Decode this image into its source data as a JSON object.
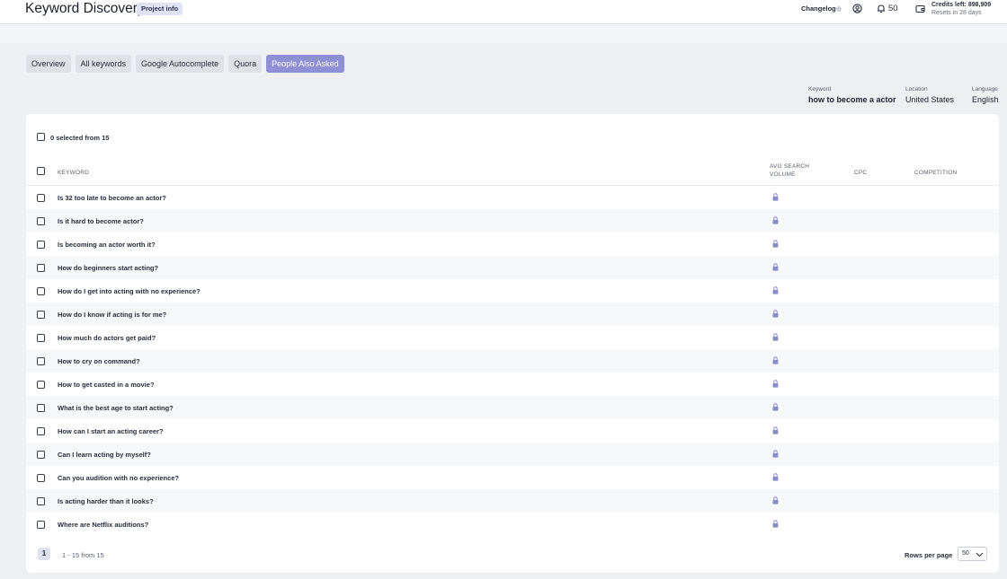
{
  "header": {
    "title": "Keyword Discovery",
    "project_badge": "Project info",
    "changelog": "Changelog",
    "notifications_count": "50",
    "credits_line1": "Credits left: 898,909",
    "credits_line2": "Resets in 28 days"
  },
  "tabs": [
    {
      "label": "Overview",
      "active": false
    },
    {
      "label": "All keywords",
      "active": false
    },
    {
      "label": "Google Autocomplete",
      "active": false
    },
    {
      "label": "Quora",
      "active": false
    },
    {
      "label": "People Also Asked",
      "active": true
    }
  ],
  "filters": {
    "keyword_label": "Keyword",
    "keyword_value": "how to become a actor",
    "location_label": "Location",
    "location_value": "United States",
    "language_label": "Language",
    "language_value": "English"
  },
  "table": {
    "selected_text": "0 selected from 15",
    "columns": {
      "keyword": "KEYWORD",
      "volume_line1": "AVG SEARCH",
      "volume_line2": "VOLUME",
      "cpc": "CPC",
      "competition": "COMPETITION"
    },
    "rows": [
      "Is 32 too late to become an actor?",
      "Is it hard to become actor?",
      "Is becoming an actor worth it?",
      "How do beginners start acting?",
      "How do I get into acting with no experience?",
      "How do I know if acting is for me?",
      "How much do actors get paid?",
      "How to cry on command?",
      "How to get casted in a movie?",
      "What is the best age to start acting?",
      "How can I start an acting career?",
      "Can I learn acting by myself?",
      "Can you audition with no experience?",
      "Is acting harder than it looks?",
      "Where are Netflix auditions?"
    ]
  },
  "pagination": {
    "current_page": "1",
    "range_text": "1 - 15 from 15",
    "rows_per_page_label": "Rows per page",
    "rows_per_page_value": "50"
  },
  "icons": {
    "user": "user-circle-icon",
    "bell": "bell-icon",
    "credits": "wallet-icon",
    "lock": "lock-icon",
    "select_arrow": "chevron-down-icon"
  },
  "colors": {
    "accent": "#8f8fd6",
    "lock": "#8a8cc7",
    "background": "#eef0f4"
  }
}
